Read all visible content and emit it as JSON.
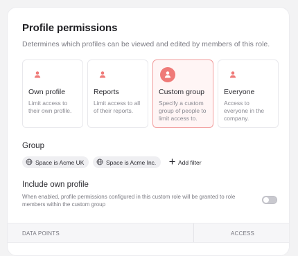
{
  "header": {
    "title": "Profile permissions",
    "subtitle": "Determines which profiles can be viewed and edited by members of this role."
  },
  "cards": [
    {
      "label": "Own profile",
      "description": "Limit access to their own profile.",
      "selected": false,
      "icon": "person-icon"
    },
    {
      "label": "Reports",
      "description": "Limit access to all of their reports.",
      "selected": false,
      "icon": "person-icon"
    },
    {
      "label": "Custom group",
      "description": "Specify a custom group of people to limit access to.",
      "selected": true,
      "icon": "person-icon"
    },
    {
      "label": "Everyone",
      "description": "Access to everyone in the company.",
      "selected": false,
      "icon": "person-icon"
    }
  ],
  "group": {
    "heading": "Group",
    "chips": [
      {
        "label": "Space is Acme UK",
        "icon": "globe-icon"
      },
      {
        "label": "Space is Acme Inc.",
        "icon": "globe-icon"
      }
    ],
    "add_filter_label": "Add filter"
  },
  "include_own": {
    "heading": "Include own profile",
    "help": "When enabled, profile permissions configured in this custom role will be granted to role members within the custom group",
    "toggle_on": false
  },
  "table": {
    "col_data_points": "DATA POINTS",
    "col_access": "ACCESS"
  },
  "colors": {
    "accent": "#ef7a78",
    "selected_border": "#f19b9b",
    "selected_bg": "#fff5f5"
  }
}
